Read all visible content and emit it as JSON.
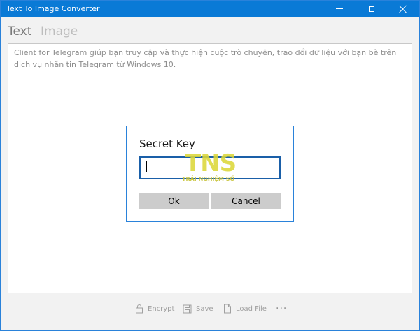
{
  "window": {
    "title": "Text To Image Converter"
  },
  "tabs": [
    {
      "label": "Text"
    },
    {
      "label": "Image"
    }
  ],
  "editor": {
    "text": "Client for Telegram giúp bạn truy cập và thực hiện cuộc trò chuyện, trao đổi dữ liệu với bạn bè trên dịch vụ nhắn tin Telegram từ Windows 10."
  },
  "commands": {
    "encrypt": "Encrypt",
    "save": "Save",
    "load_file": "Load File",
    "more": "···"
  },
  "dialog": {
    "title": "Secret Key",
    "input_value": "",
    "ok_label": "Ok",
    "cancel_label": "Cancel"
  },
  "watermark": {
    "logo": "TNS",
    "sub": "TRẢI NGHIỆM SỐ"
  },
  "colors": {
    "accent": "#0a7ad6",
    "dialog_border": "#2a82da",
    "watermark": "#dcd83a"
  }
}
